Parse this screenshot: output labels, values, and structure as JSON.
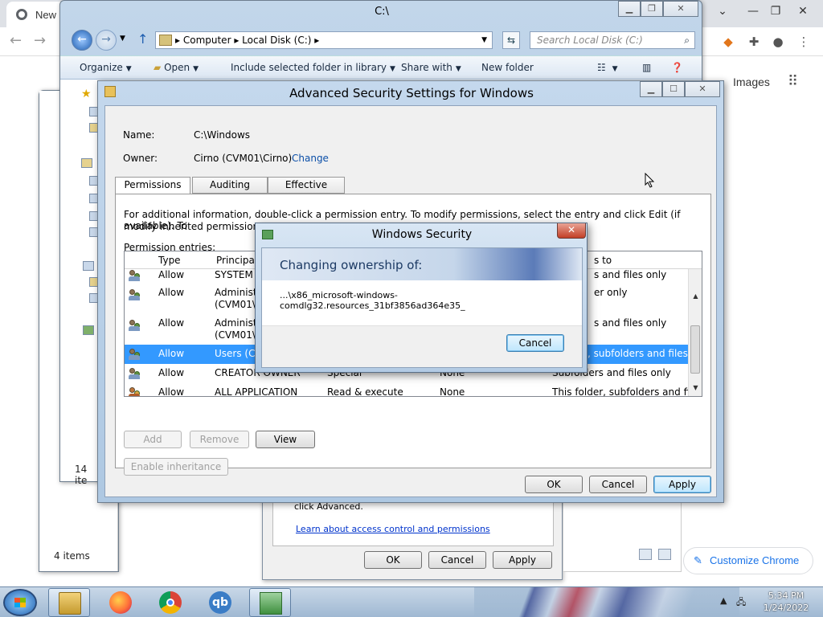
{
  "chrome": {
    "tab_title": "New",
    "images_link": "Images",
    "customize_label": "Customize Chrome",
    "icons": [
      "chrome-icon",
      "metamask-icon",
      "extensions-icon",
      "profile-icon",
      "more-icon"
    ]
  },
  "explorer": {
    "title": "C:\\",
    "address": [
      "Computer",
      "Local Disk (C:)"
    ],
    "search_placeholder": "Search Local Disk (C:)",
    "commands": {
      "organize": "Organize",
      "open": "Open",
      "include": "Include selected folder in library",
      "share": "Share with",
      "new_folder": "New folder"
    },
    "status": "14 ite"
  },
  "explorer2": {
    "status": "4 items"
  },
  "props": {
    "text": "click Advanced.",
    "link": "Learn about access control and permissions",
    "ok": "OK",
    "cancel": "Cancel",
    "apply": "Apply"
  },
  "advanced": {
    "title": "Advanced Security Settings for Windows",
    "name_label": "Name:",
    "name_value": "C:\\Windows",
    "owner_label": "Owner:",
    "owner_value": "Cirno (CVM01\\Cirno)",
    "change_link": "Change",
    "tabs": [
      "Permissions",
      "Auditing",
      "Effective Access"
    ],
    "info": "For additional information, double-click a permission entry. To modify permissions, select the entry and click Edit (if available). To",
    "info2_a": "modify inherited permissions, c",
    "perm_entries_label": "Permission entries:",
    "columns": {
      "type": "Type",
      "principal": "Principal",
      "applies": "s to"
    },
    "rows": [
      {
        "type": "Allow",
        "principal": "SYSTEM",
        "principal2": "",
        "access": "",
        "inherited": "",
        "applies": "s and files only",
        "selected": false
      },
      {
        "type": "Allow",
        "principal": "Administra",
        "principal2": "(CVM01\\A",
        "access": "",
        "inherited": "",
        "applies": "er only",
        "selected": false
      },
      {
        "type": "Allow",
        "principal": "Administra",
        "principal2": "(CVM01\\A",
        "access": "",
        "inherited": "",
        "applies": "s and files only",
        "selected": false
      },
      {
        "type": "Allow",
        "principal": "Users (CV",
        "principal2": "",
        "access": "",
        "inherited": "",
        "applies": ", subfolders and files",
        "selected": true
      },
      {
        "type": "Allow",
        "principal": "CREATOR OWNER",
        "principal2": "",
        "access": "Special",
        "inherited": "None",
        "applies": "Subfolders and files only",
        "selected": false
      },
      {
        "type": "Allow",
        "principal": "ALL APPLICATION",
        "principal2": "",
        "access": "Read & execute",
        "inherited": "None",
        "applies": "This folder, subfolders and files",
        "selected": false
      }
    ],
    "buttons": {
      "add": "Add",
      "remove": "Remove",
      "view": "View",
      "enable_inheritance": "Enable inheritance",
      "ok": "OK",
      "cancel": "Cancel",
      "apply": "Apply"
    }
  },
  "security": {
    "title": "Windows Security",
    "heading": "Changing ownership of:",
    "path": "...\\x86_microsoft-windows-comdlg32.resources_31bf3856ad364e35_",
    "cancel": "Cancel"
  },
  "taskbar": {
    "apps": [
      "explorer-icon",
      "firefox-icon",
      "chrome-icon",
      "qbittorrent-icon",
      "security-dialog-icon"
    ],
    "qb_text": "qb",
    "time": "5:34 PM",
    "date": "1/24/2022"
  }
}
